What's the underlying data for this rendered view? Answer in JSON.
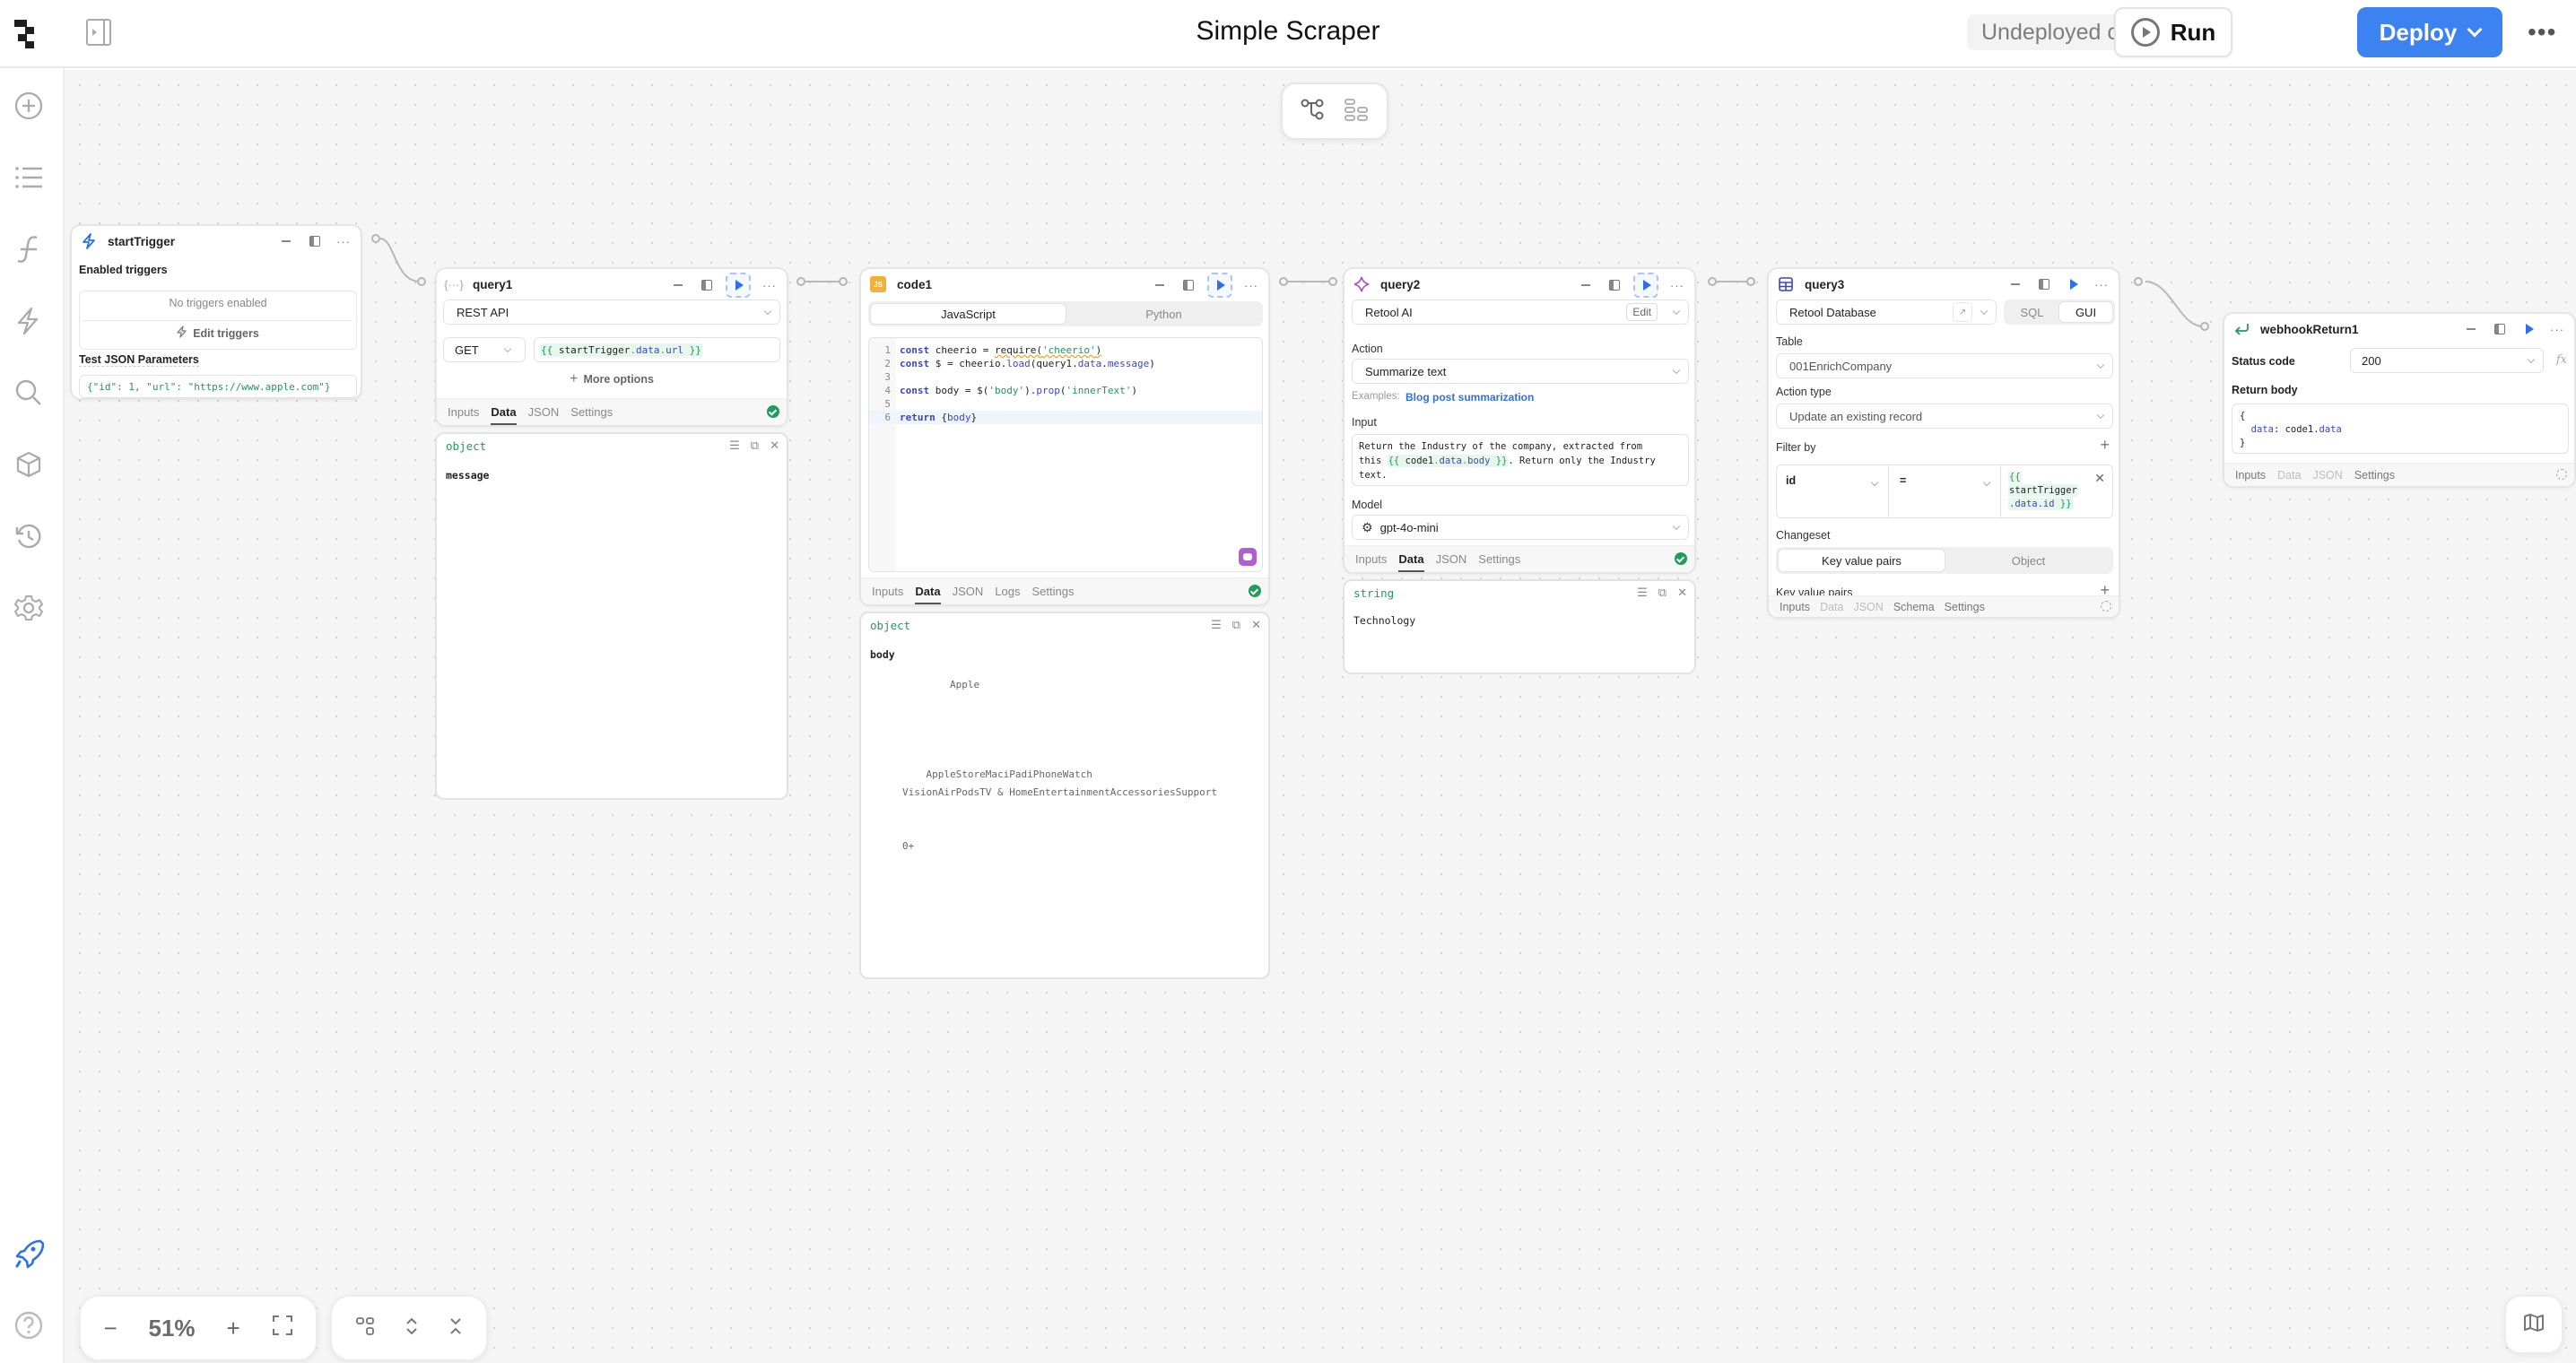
{
  "header": {
    "title": "Simple Scraper",
    "undeployed_label": "Undeployed changes",
    "run_label": "Run",
    "deploy_label": "Deploy",
    "more_label": "•••"
  },
  "sidebar": {
    "items": [
      {
        "name": "add",
        "icon": "plus-circle-icon"
      },
      {
        "name": "list",
        "icon": "list-icon"
      },
      {
        "name": "functions",
        "icon": "function-icon"
      },
      {
        "name": "triggers",
        "icon": "lightning-icon"
      },
      {
        "name": "search",
        "icon": "search-icon"
      },
      {
        "name": "resources",
        "icon": "cube-icon"
      },
      {
        "name": "history",
        "icon": "history-icon"
      },
      {
        "name": "settings",
        "icon": "gear-icon"
      }
    ],
    "bottom": [
      {
        "name": "deploy",
        "icon": "rocket-icon",
        "color": "#2f6fe8"
      },
      {
        "name": "help",
        "icon": "help-circle-icon"
      }
    ]
  },
  "canvas": {
    "zoom_value": "51%",
    "view_toggle": [
      "graph-view-icon",
      "list-view-icon"
    ]
  },
  "blocks": {
    "startTrigger": {
      "name": "startTrigger",
      "enabled_triggers_label": "Enabled triggers",
      "no_triggers": "No triggers enabled",
      "edit_triggers": "Edit triggers",
      "test_params_label": "Test JSON Parameters",
      "test_params_value": "{\"id\": 1, \"url\": \"https://www.apple.com\"}"
    },
    "query1": {
      "name": "query1",
      "resource": "REST API",
      "method": "GET",
      "url_open": "{{ ",
      "url_id": "startTrigger",
      "url_dot1": ".",
      "url_prop1": "data",
      "url_dot2": ".",
      "url_prop2": "url",
      "url_close": " }}",
      "more_options": "More options",
      "tabs": [
        "Inputs",
        "Data",
        "JSON",
        "Settings"
      ],
      "active_tab": "Data",
      "result": {
        "type": "object",
        "body": "message"
      }
    },
    "code1": {
      "name": "code1",
      "icon_label": "JS",
      "languages": [
        "JavaScript",
        "Python"
      ],
      "active_language": "JavaScript",
      "code_lines": [
        "const cheerio = require('cheerio')",
        "const $ = cheerio.load(query1.data.message)",
        "",
        "const body = $('body').prop('innerText')",
        "",
        "return {body}"
      ],
      "tabs": [
        "Inputs",
        "Data",
        "JSON",
        "Logs",
        "Settings"
      ],
      "active_tab": "Data",
      "result": {
        "type": "object",
        "key": "body",
        "lines": [
          "        Apple",
          "",
          "",
          "",
          "",
          "    AppleStoreMaciPadiPhoneWatch",
          "VisionAirPodsTV & HomeEntertainmentAccessoriesSupport",
          "",
          "",
          "0+"
        ]
      }
    },
    "query2": {
      "name": "query2",
      "resource": "Retool AI",
      "edit_label": "Edit",
      "action_label": "Action",
      "action_value": "Summarize text",
      "examples_label": "Examples:",
      "examples_link": "Blog post summarization",
      "input_label": "Input",
      "input_text_1": "Return the Industry of the company, extracted from",
      "input_text_2a": "this ",
      "input_tmpl_open": "{{ ",
      "input_tmpl_id": "code1",
      "input_tmpl_prop1": "data",
      "input_tmpl_prop2": "body",
      "input_tmpl_close": " }}",
      "input_text_2b": ". Return only the Industry",
      "input_text_3": "text.",
      "model_label": "Model",
      "model_value": "gpt-4o-mini",
      "tabs": [
        "Inputs",
        "Data",
        "JSON",
        "Settings"
      ],
      "active_tab": "Data",
      "result": {
        "type": "string",
        "body": "Technology"
      }
    },
    "query3": {
      "name": "query3",
      "resource": "Retool Database",
      "modes": [
        "SQL",
        "GUI"
      ],
      "active_mode": "GUI",
      "table_label": "Table",
      "table_value": "001EnrichCompany",
      "action_type_label": "Action type",
      "action_type_value": "Update an existing record",
      "filter_label": "Filter by",
      "filter": {
        "column": "id",
        "operator": "=",
        "value_line1": "{{",
        "value_line2": "startTrigger",
        "value_line3_prop": ".data.id",
        "value_line3_close": " }}"
      },
      "changeset_label": "Changeset",
      "changeset_modes": [
        "Key value pairs",
        "Object"
      ],
      "active_changeset": "Key value pairs",
      "kv_label": "Key value pairs",
      "tabs": [
        "Inputs",
        "Data",
        "JSON",
        "Schema",
        "Settings"
      ]
    },
    "webhookReturn1": {
      "name": "webhookReturn1",
      "status_label": "Status code",
      "status_value": "200",
      "fx_label": "fx",
      "body_label": "Return body",
      "body_lines": [
        "{",
        "  data: code1.data",
        "}"
      ],
      "tabs": [
        "Inputs",
        "Data",
        "JSON",
        "Settings"
      ]
    }
  },
  "colors": {
    "accent": "#3c82f0",
    "success": "#1e9e59",
    "template_bg": "#e8f7ee",
    "template_text": "#1c9a55",
    "property": "#3b45c9"
  }
}
